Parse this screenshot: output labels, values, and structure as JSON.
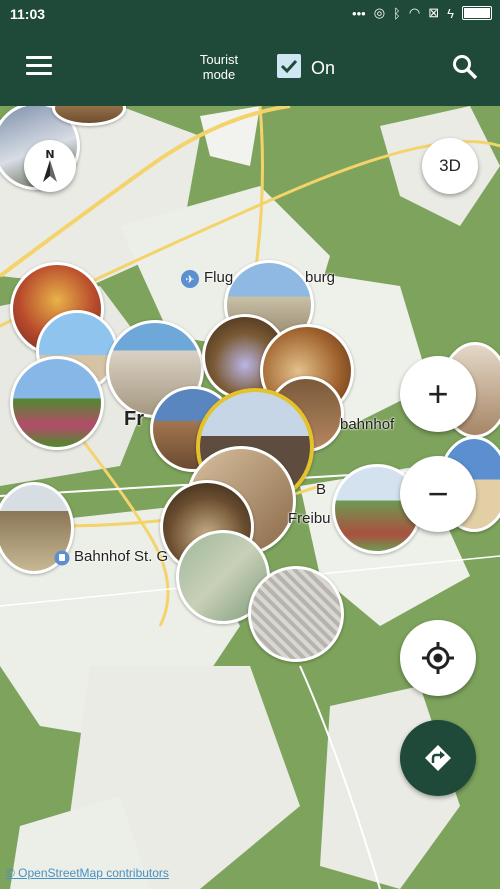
{
  "status_bar": {
    "time": "11:03",
    "icons": [
      "dots-icon",
      "signal-icon",
      "bluetooth-icon",
      "wifi-icon",
      "sim-icon",
      "flash-icon",
      "battery-icon"
    ]
  },
  "appbar": {
    "tourist_mode_label": "Tourist mode",
    "toggle_state_label": "On",
    "toggle_checked": true
  },
  "map": {
    "button_3d": "3D",
    "zoom_in": "+",
    "zoom_out": "−",
    "labels": {
      "airport": "Flug",
      "airport_suffix": "burg",
      "station_fragment": "bahnhof",
      "bahnhof_st": "Bahnhof St. G",
      "freiburg_fragment": "Freibu",
      "city_fragment_1": "Fr",
      "city_fragment_2": "B"
    },
    "attribution": "© OpenStreetMap contributors"
  },
  "colors": {
    "appbar": "#1f4a3a",
    "map_green": "#7da35c",
    "accent_fab": "#1f4a3a"
  }
}
